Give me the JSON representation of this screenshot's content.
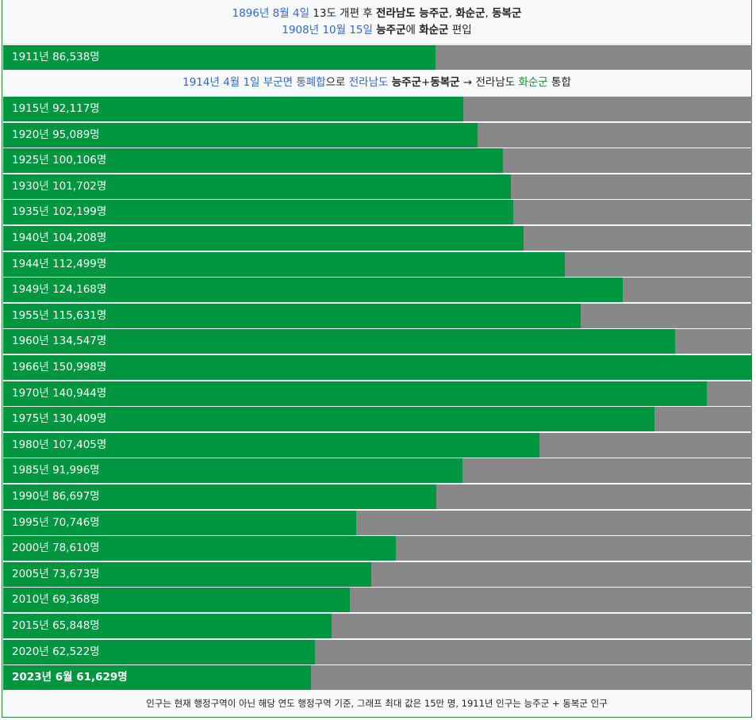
{
  "header_note": {
    "line1": [
      {
        "text": "1896년 8월 4일",
        "style": "link"
      },
      {
        "text": " 13도 개편 후 ",
        "style": "plain"
      },
      {
        "text": "전라남도 능주군",
        "style": "bold"
      },
      {
        "text": ", ",
        "style": "plain"
      },
      {
        "text": "화순군",
        "style": "bold"
      },
      {
        "text": ", ",
        "style": "plain"
      },
      {
        "text": "동복군",
        "style": "bold"
      }
    ],
    "line2": [
      {
        "text": "1908년 10월 15일",
        "style": "link"
      },
      {
        "text": " ",
        "style": "plain"
      },
      {
        "text": "능주군",
        "style": "bold"
      },
      {
        "text": "에 ",
        "style": "plain"
      },
      {
        "text": "화순군",
        "style": "bold"
      },
      {
        "text": " 편입",
        "style": "plain"
      }
    ]
  },
  "merge_note": [
    {
      "text": "1914년 4월 1일",
      "style": "link"
    },
    {
      "text": " ",
      "style": "plain"
    },
    {
      "text": "부군면 통폐합",
      "style": "link"
    },
    {
      "text": "으로 ",
      "style": "plain"
    },
    {
      "text": "전라남도",
      "style": "link"
    },
    {
      "text": " ",
      "style": "plain"
    },
    {
      "text": "능주군",
      "style": "bold"
    },
    {
      "text": "+",
      "style": "plain"
    },
    {
      "text": "동복군",
      "style": "bold"
    },
    {
      "text": " → 전라남도 ",
      "style": "plain"
    },
    {
      "text": "화순군",
      "style": "green"
    },
    {
      "text": " 통합",
      "style": "plain"
    }
  ],
  "footer_note": "인구는 현재 행정구역이 아닌 해당 연도 행정구역 기준, 그래프 최대 값은 15만 명, 1911년 인구는 능주군 + 동복군 인구",
  "colors": {
    "bar": "#009640",
    "remainder": "#888888",
    "link": "#3366cc"
  },
  "chart_data": {
    "type": "bar",
    "orientation": "horizontal",
    "max_value": 150000,
    "bars": [
      {
        "label": "1911년 86,538명",
        "year": 1911,
        "value": 86538
      },
      {
        "label": "1915년 92,117명",
        "year": 1915,
        "value": 92117
      },
      {
        "label": "1920년 95,089명",
        "year": 1920,
        "value": 95089
      },
      {
        "label": "1925년 100,106명",
        "year": 1925,
        "value": 100106
      },
      {
        "label": "1930년 101,702명",
        "year": 1930,
        "value": 101702
      },
      {
        "label": "1935년 102,199명",
        "year": 1935,
        "value": 102199
      },
      {
        "label": "1940년 104,208명",
        "year": 1940,
        "value": 104208
      },
      {
        "label": "1944년 112,499명",
        "year": 1944,
        "value": 112499
      },
      {
        "label": "1949년 124,168명",
        "year": 1949,
        "value": 124168
      },
      {
        "label": "1955년 115,631명",
        "year": 1955,
        "value": 115631
      },
      {
        "label": "1960년 134,547명",
        "year": 1960,
        "value": 134547
      },
      {
        "label": "1966년 150,998명",
        "year": 1966,
        "value": 150998
      },
      {
        "label": "1970년 140,944명",
        "year": 1970,
        "value": 140944
      },
      {
        "label": "1975년 130,409명",
        "year": 1975,
        "value": 130409
      },
      {
        "label": "1980년 107,405명",
        "year": 1980,
        "value": 107405
      },
      {
        "label": "1985년 91,996명",
        "year": 1985,
        "value": 91996
      },
      {
        "label": "1990년 86,697명",
        "year": 1990,
        "value": 86697
      },
      {
        "label": "1995년 70,746명",
        "year": 1995,
        "value": 70746
      },
      {
        "label": "2000년 78,610명",
        "year": 2000,
        "value": 78610
      },
      {
        "label": "2005년 73,673명",
        "year": 2005,
        "value": 73673
      },
      {
        "label": "2010년 69,368명",
        "year": 2010,
        "value": 69368
      },
      {
        "label": "2015년 65,848명",
        "year": 2015,
        "value": 65848
      },
      {
        "label": "2020년 62,522명",
        "year": 2020,
        "value": 62522
      },
      {
        "label": "2023년 6월 61,629명",
        "year": 2023,
        "value": 61629,
        "bold": true
      }
    ]
  }
}
